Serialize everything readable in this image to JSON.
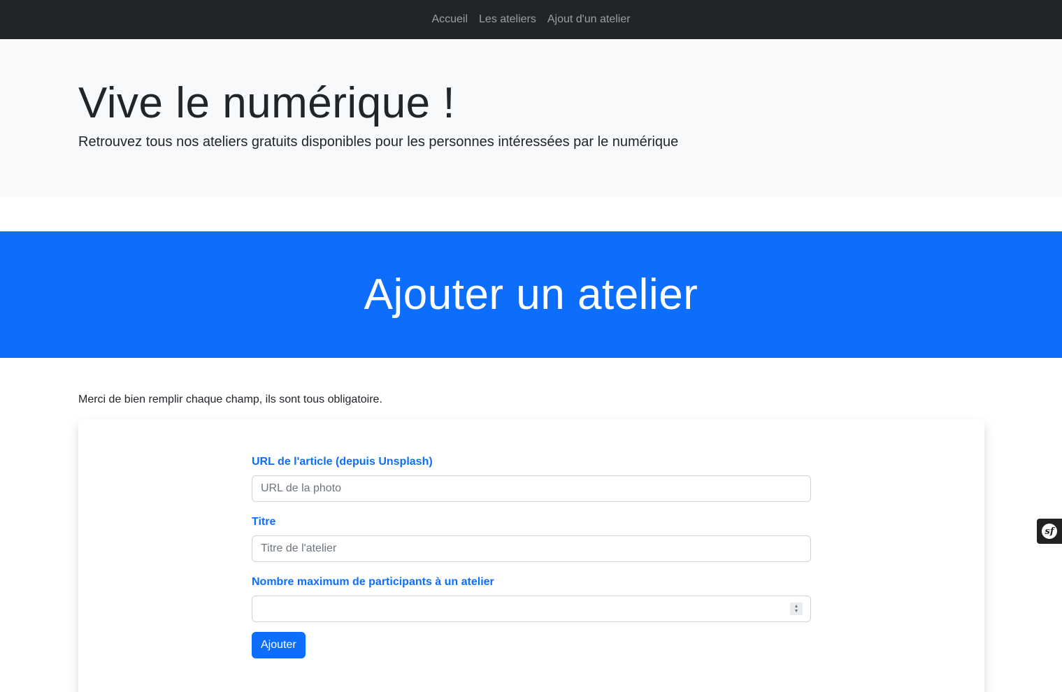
{
  "nav": {
    "items": [
      {
        "label": "Accueil"
      },
      {
        "label": "Les ateliers"
      },
      {
        "label": "Ajout d'un atelier"
      }
    ]
  },
  "hero": {
    "title": "Vive le numérique !",
    "lead": "Retrouvez tous nos ateliers gratuits disponibles pour les personnes intéressées par le numérique"
  },
  "banner": {
    "title": "Ajouter un atelier"
  },
  "intro": "Merci de bien remplir chaque champ, ils sont tous obligatoire.",
  "form": {
    "url_label": "URL de l'article (depuis Unsplash)",
    "url_placeholder": "URL de la photo",
    "url_value": "",
    "title_label": "Titre",
    "title_placeholder": "Titre de l'atelier",
    "title_value": "",
    "max_label": "Nombre maximum de participants à un atelier",
    "max_value": "",
    "submit_label": "Ajouter"
  },
  "toolbar": {
    "logo_text": "sf"
  },
  "colors": {
    "navbar": "#212529",
    "hero_bg": "#f8f9fa",
    "primary": "#0d6efd"
  }
}
